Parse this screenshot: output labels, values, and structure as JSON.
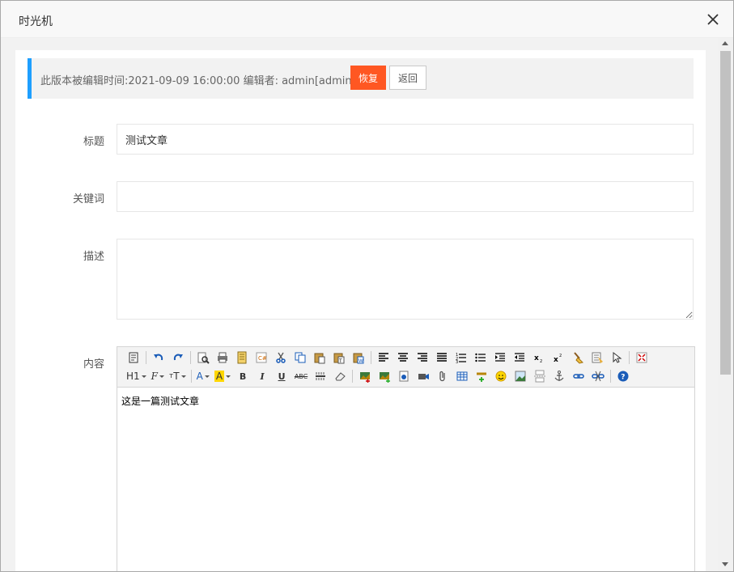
{
  "dialog": {
    "title": "时光机",
    "close_icon": "close-icon"
  },
  "notice": {
    "text": "此版本被编辑时间:2021-09-09 16:00:00 编辑者: admin[admin]",
    "restore_label": "恢复",
    "back_label": "返回",
    "accent": "#1e9fff",
    "restore_color": "#ff5722"
  },
  "form": {
    "title_label": "标题",
    "title_value": "测试文章",
    "keywords_label": "关键词",
    "keywords_value": "",
    "description_label": "描述",
    "description_value": "",
    "content_label": "内容"
  },
  "editor": {
    "heading_combo": "H1",
    "font_combo": "F",
    "size_combo": "T",
    "color_combo": "A",
    "highlight_combo": "A",
    "bold": "B",
    "italic": "I",
    "underline": "U",
    "strike": "ABC",
    "content": "这是一篇测试文章"
  }
}
